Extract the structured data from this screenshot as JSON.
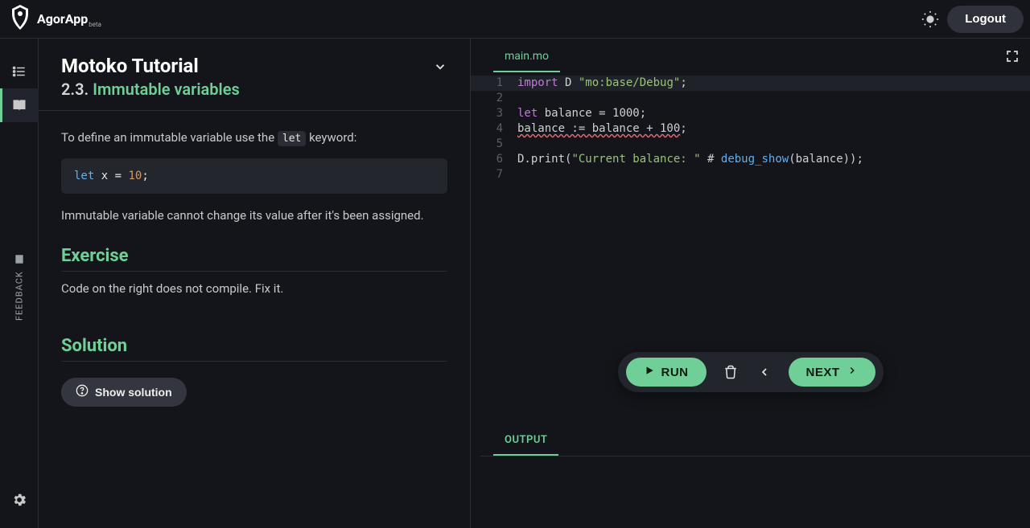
{
  "brand": {
    "name": "AgorApp",
    "beta": "beta"
  },
  "topbar": {
    "logout": "Logout"
  },
  "rail": {
    "feedback": "FEEDBACK"
  },
  "lesson": {
    "title": "Motoko Tutorial",
    "section_num": "2.3.",
    "section_name": "Immutable variables",
    "desc_pre": "To define an immutable variable use the ",
    "let_kw": "let",
    "desc_post": " keyword:",
    "snippet_kw": "let",
    "snippet_rest": " x = ",
    "snippet_num": "10",
    "snippet_tail": ";",
    "para2": "Immutable variable cannot change its value after it's been assigned.",
    "exercise_h": "Exercise",
    "exercise_body": "Code on the right does not compile. Fix it.",
    "solution_h": "Solution",
    "show_solution": "Show solution"
  },
  "editor": {
    "tab": "main.mo",
    "lines": [
      {
        "n": "1",
        "tokens": [
          {
            "t": "import",
            "c": "tok-kw"
          },
          {
            "t": " D ",
            "c": ""
          },
          {
            "t": "\"mo:base/Debug\"",
            "c": "tok-str"
          },
          {
            "t": ";",
            "c": ""
          }
        ],
        "hl": true
      },
      {
        "n": "2",
        "tokens": []
      },
      {
        "n": "3",
        "tokens": [
          {
            "t": "let",
            "c": "tok-kw"
          },
          {
            "t": " balance = 1000;",
            "c": ""
          }
        ]
      },
      {
        "n": "4",
        "tokens": [
          {
            "t": "balance := balance + 100",
            "c": "err-underline"
          },
          {
            "t": ";",
            "c": ""
          }
        ]
      },
      {
        "n": "5",
        "tokens": []
      },
      {
        "n": "6",
        "tokens": [
          {
            "t": "D.print(",
            "c": ""
          },
          {
            "t": "\"Current balance: \"",
            "c": "tok-str"
          },
          {
            "t": " # ",
            "c": ""
          },
          {
            "t": "debug_show",
            "c": "tok-fn"
          },
          {
            "t": "(balance));",
            "c": ""
          }
        ]
      },
      {
        "n": "7",
        "tokens": []
      }
    ]
  },
  "runbar": {
    "run": "RUN",
    "next": "NEXT"
  },
  "output": {
    "tab": "OUTPUT"
  }
}
